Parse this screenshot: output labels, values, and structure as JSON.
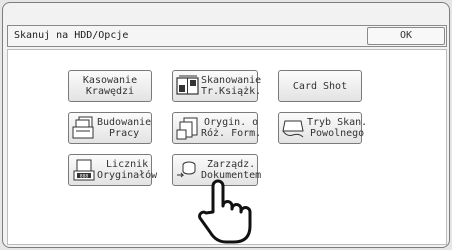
{
  "header": {
    "title": "Skanuj na HDD/Opcje",
    "ok_label": "OK"
  },
  "buttons": {
    "erase_edges": {
      "line1": "Kasowanie",
      "line2": "Krawędzi",
      "icon": "none"
    },
    "book_scan": {
      "line1": "Skanowanie",
      "line2": "Tr.Książk.",
      "icon": "book-scan-icon"
    },
    "card_shot": {
      "line1": "Card Shot",
      "icon": "none"
    },
    "job_build": {
      "line1": "Budowanie",
      "line2": "Pracy",
      "icon": "job-build-icon"
    },
    "mixed_size": {
      "line1": "Orygin. o",
      "line2": "Róż. Form.",
      "icon": "mixed-size-icon"
    },
    "slow_scan": {
      "line1": "Tryb Skan.",
      "line2": "Powolnego",
      "icon": "slow-scan-icon"
    },
    "original_counter": {
      "line1": "Licznik",
      "line2": "Oryginałów",
      "icon": "counter-icon"
    },
    "doc_filing": {
      "line1": "Zarządz.",
      "line2": "Dokumentem",
      "icon": "document-filing-icon"
    }
  },
  "pointer": {
    "icon": "hand-pointer-icon"
  }
}
